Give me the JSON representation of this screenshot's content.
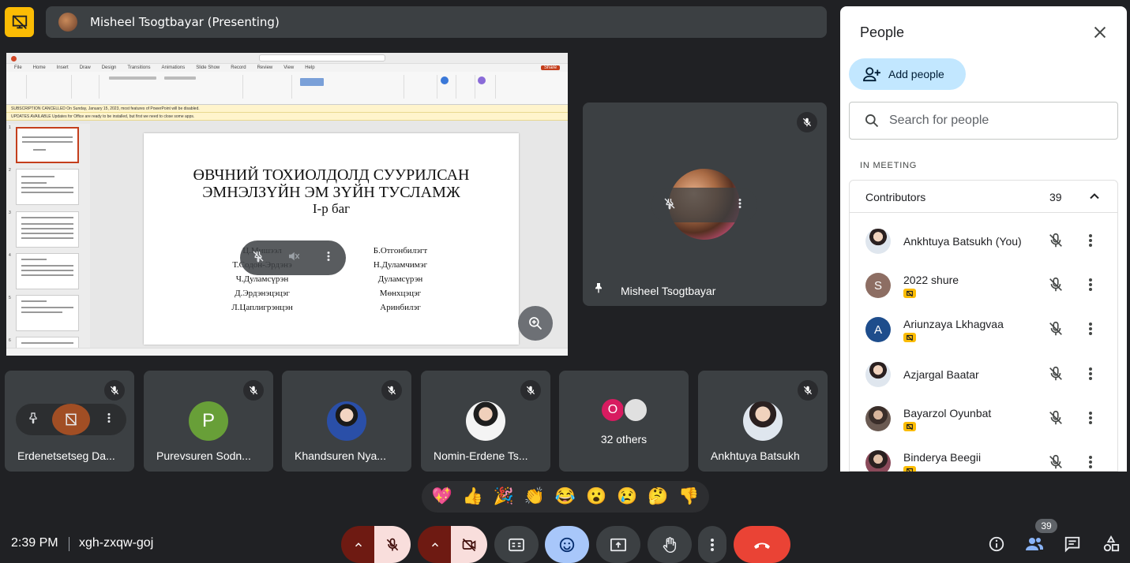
{
  "presenting": {
    "name": "Misheel Tsogtbayar (Presenting)"
  },
  "slide": {
    "title_line1": "ӨВЧНИЙ ТОХИОЛДОЛД СУУРИЛСАН",
    "title_line2": "ЭМНЭЛЗҮЙН ЭМ ЗҮЙН ТУСЛАМЖ",
    "subtitle": "I-р баг",
    "names_left": [
      "Ц.Мишээл",
      "Т.Содон-Эрдэнэ",
      "Ч.Дуламсүрэн",
      "Д.Эрдэнэцэцэг",
      "Л.Цаплигрэнцэн"
    ],
    "names_right": [
      "Б.Отгонбилэгт",
      "Н.Дуламчимэг",
      "Дуламсүрэн",
      "Мөнхцэцэг",
      "Аринбилэг"
    ],
    "menu": [
      "File",
      "Home",
      "Insert",
      "Draw",
      "Design",
      "Transitions",
      "Animations",
      "Slide Show",
      "Record",
      "Review",
      "View",
      "Help"
    ],
    "share_label": "Share",
    "banner1": "SUBSCRIPTION CANCELLED   On Sunday, January 15, 2023, most features of PowerPoint will be disabled.",
    "banner2": "UPDATES AVAILABLE   Updates for Office are ready to be installed, but first we need to close some apps."
  },
  "presenter_tile": {
    "name": "Misheel Tsogtbayar"
  },
  "tiles": [
    {
      "name": "Erdenetsetseg Da...",
      "type": "photo"
    },
    {
      "name": "Purevsuren Sodn...",
      "initial": "P",
      "color": "#689f38"
    },
    {
      "name": "Khandsuren Nya...",
      "type": "photo"
    },
    {
      "name": "Nomin-Erdene Ts...",
      "type": "photo"
    },
    {
      "others_label": "32 others",
      "initial": "O"
    },
    {
      "name": "Ankhtuya Batsukh",
      "type": "photo"
    }
  ],
  "reactions": [
    "💖",
    "👍",
    "🎉",
    "👏",
    "😂",
    "😮",
    "😢",
    "🤔",
    "👎"
  ],
  "bottom": {
    "time": "2:39 PM",
    "code": "xgh-zxqw-goj",
    "people_count": "39"
  },
  "panel": {
    "title": "People",
    "add_label": "Add people",
    "search_placeholder": "Search for people",
    "section": "IN MEETING",
    "group_label": "Contributors",
    "group_count": "39",
    "people": [
      {
        "name": "Ankhtuya Batsukh (You)",
        "badge": false
      },
      {
        "name": "2022 shure",
        "initial": "S",
        "color": "#8d6e63",
        "badge": true
      },
      {
        "name": "Ariunzaya Lkhagvaa",
        "initial": "A",
        "color": "#1e4d8c",
        "badge": true
      },
      {
        "name": "Azjargal Baatar",
        "badge": false
      },
      {
        "name": "Bayarzol Oyunbat",
        "badge": true
      },
      {
        "name": "Binderya Beegii",
        "badge": true
      }
    ]
  },
  "colors": {
    "accent": "#a8c7fa",
    "end_call": "#ea4335",
    "presenting_icon": "#fbbc04",
    "mic_off_bg": "#f9dedc"
  }
}
